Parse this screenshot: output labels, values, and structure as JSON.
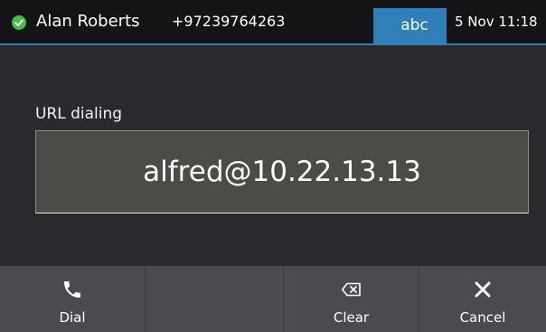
{
  "statusbar": {
    "user_name": "Alan Roberts",
    "phone_number": "+97239764263",
    "input_mode": "abc",
    "datetime": "5 Nov 11:18",
    "status_icon": "check-circle-icon",
    "status_color": "#3ec33e"
  },
  "main": {
    "field_label": "URL dialing",
    "url_value": "alfred@10.22.13.13"
  },
  "softkeys": [
    {
      "label": "Dial",
      "icon": "phone-icon"
    },
    {
      "label": "",
      "icon": ""
    },
    {
      "label": "",
      "icon": ""
    },
    {
      "label": "Clear",
      "icon": "backspace-icon"
    },
    {
      "label": "Cancel",
      "icon": "close-icon"
    }
  ],
  "colors": {
    "accent": "#2f7fb9",
    "background": "#2a2a2e",
    "softkey_bar": "#4a4b4e",
    "input_fill": "#4a4c48"
  }
}
